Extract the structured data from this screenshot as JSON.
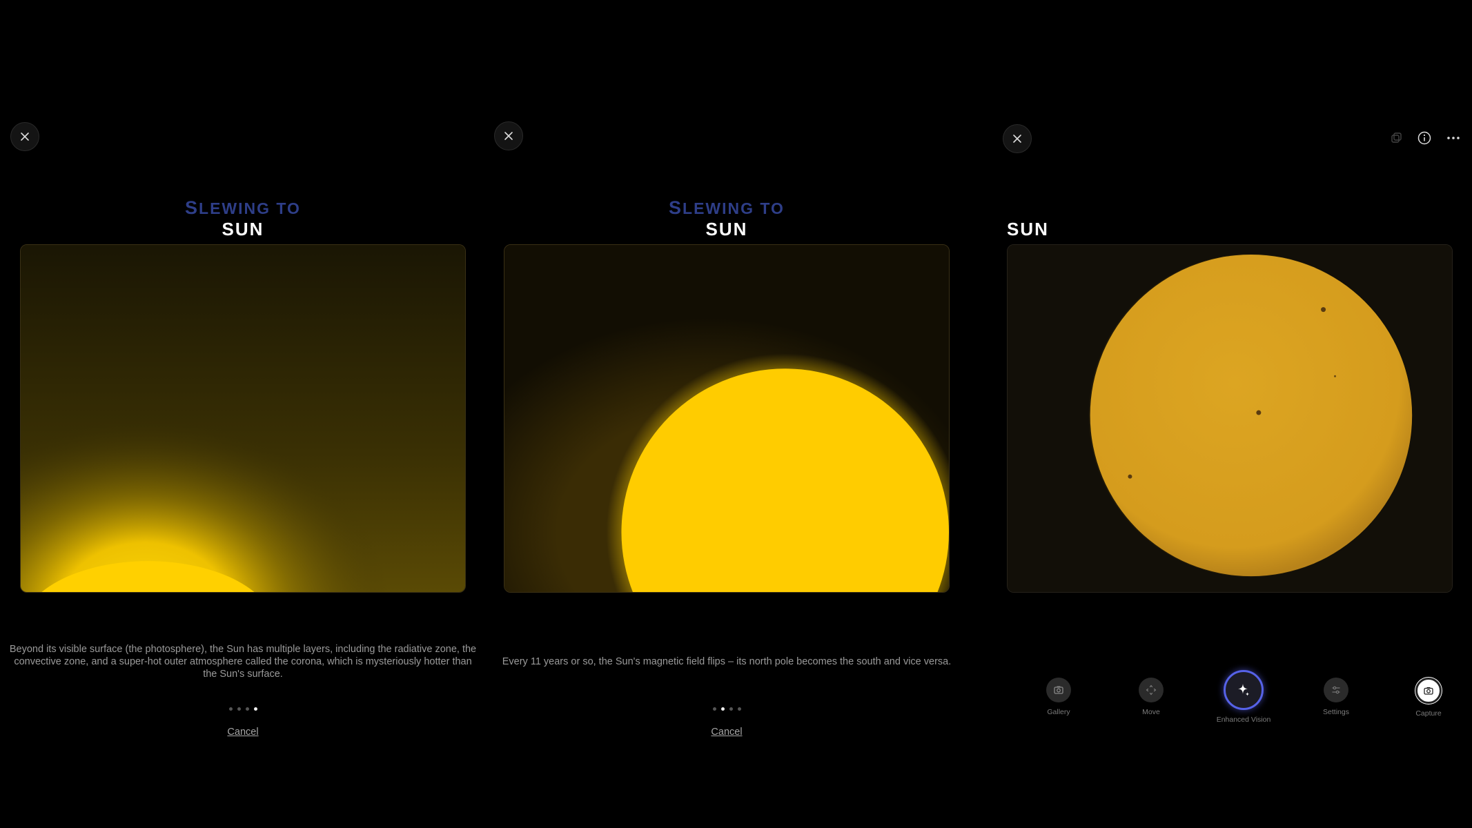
{
  "panels": [
    {
      "close_icon": "close-icon",
      "slewing_first": "S",
      "slewing_rest": "LEWING TO",
      "target": "SUN",
      "fact": "Beyond its visible surface (the photosphere), the Sun has multiple layers, including the radiative zone, the convective zone, and a super-hot outer atmosphere called the corona, which is mysteriously hotter than the Sun's surface.",
      "dots_total": 4,
      "dots_active": 4,
      "cancel": "Cancel"
    },
    {
      "close_icon": "close-icon",
      "slewing_first": "S",
      "slewing_rest": "LEWING TO",
      "target": "SUN",
      "fact": "Every 11 years or so, the Sun's magnetic field flips – its north pole becomes the south and vice versa.",
      "dots_total": 4,
      "dots_active": 2,
      "cancel": "Cancel"
    },
    {
      "close_icon": "close-icon",
      "target": "SUN",
      "top_icons": [
        "layers-icon",
        "info-icon",
        "more-icon"
      ],
      "toolbar": [
        {
          "label": "Gallery",
          "icon": "gallery-icon"
        },
        {
          "label": "Move",
          "icon": "move-icon"
        },
        {
          "label": "Enhanced Vision",
          "icon": "sparkle-icon"
        },
        {
          "label": "Settings",
          "icon": "settings-icon"
        },
        {
          "label": "Capture",
          "icon": "camera-icon"
        }
      ]
    }
  ],
  "colors": {
    "background": "#000000",
    "slewing_accent": "#2e3e88",
    "sun_bright": "#ffcc00",
    "sun_filtered": "#d9a21e",
    "enhanced_ring": "#5662e8"
  }
}
